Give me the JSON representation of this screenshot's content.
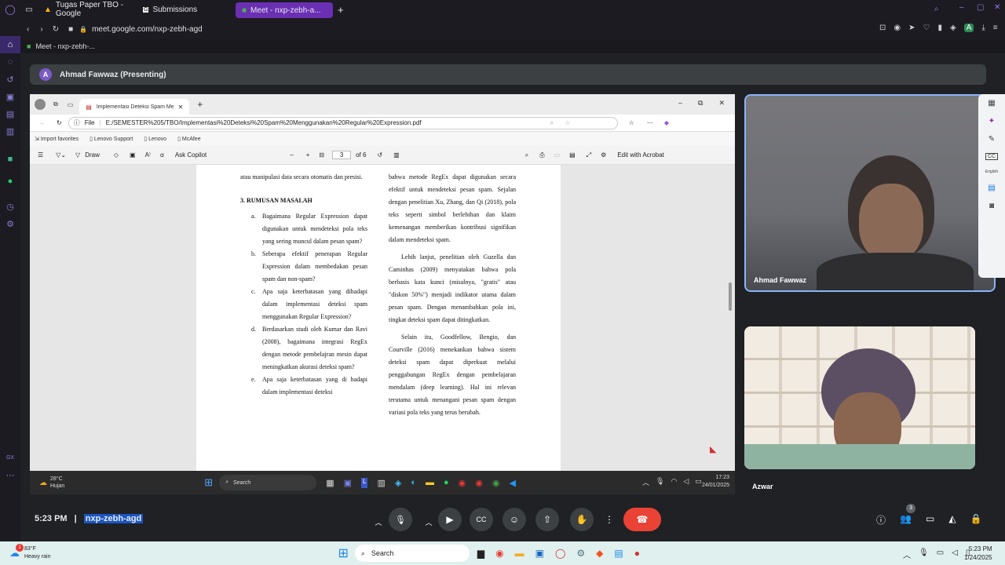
{
  "opera": {
    "tabs": [
      {
        "label": "Tugas Paper TBO - Google"
      },
      {
        "label": "Submissions"
      },
      {
        "label": "Meet - nxp-zebh-a..."
      }
    ],
    "url": "meet.google.com/nxp-zebh-agd",
    "bookmark": "Meet - nxp-zebh-..."
  },
  "meet": {
    "presenting_initial": "A",
    "presenting_label": "Ahmad Fawwaz (Presenting)",
    "time": "5:23 PM",
    "meeting_code": "nxp-zebh-agd",
    "people_count": "3",
    "tiles": [
      {
        "name": "Ahmad Fawwaz"
      },
      {
        "name": "Azwar"
      }
    ],
    "side_labels": {
      "cc": "CC",
      "lang": "English"
    }
  },
  "edge": {
    "tab_title": "Implementasi Deteksi Spam Men",
    "file_label": "File",
    "url": "E:/SEMESTER%205/TBO/Implementasi%20Deteksi%20Spam%20Menggunakan%20Regular%20Expression.pdf",
    "favorites": [
      "Import favorites",
      "Lenovo Support",
      "Lenovo",
      "McAfee"
    ]
  },
  "pdf_toolbar": {
    "draw": "Draw",
    "ask_copilot": "Ask Copilot",
    "page": "3",
    "of": "of 6",
    "edit_acrobat": "Edit with Acrobat"
  },
  "pdf": {
    "left_top": "atau manipulasi data secara otomatis dan presisi.",
    "section_title": "3. RUMUSAN MASALAH",
    "items": [
      {
        "label": "a.",
        "text": "Bagaimana Regular Expression dapat digunakan untuk mendeteksi pola teks yang sering muncul dalam pesan spam?"
      },
      {
        "label": "b.",
        "text": "Seberapa efektif penerapan Regular Expression dalam membedakan pesan spam dan non-spam?"
      },
      {
        "label": "c.",
        "text": "Apa saja keterbatasan yang dihadapi dalam implementasi deteksi spam menggunakan Regular Expression?"
      },
      {
        "label": "d.",
        "text": "Berdasarkan studi oleh Kumar dan Ravi (2008), bagaimana integrasi RegEx dengan metode pembelajran mesin dapat meningkatkan akurasi deteksi spam?"
      },
      {
        "label": "e.",
        "text": "Apa saja keterbatasan yang di hadapi dalam implementasi deteksi"
      }
    ],
    "right_p1": "bahwa metode RegEx dapat digunakan secara efektif untuk mendeteksi pesan spam. Sejalan dengan penelitian Xu, Zhang, dan Qi (2018), pola teks seperti simbol berlebihan dan klaim kemenangan memberikan kontribusi signifikan dalam mendeteksi spam.",
    "right_p2": "Lebih lanjut, penelitian oleh Guzella dan Caminhas (2009) menyatakan bahwa pola berbasis kata kunci (misalnya, \"gratis\" atau \"diskon 50%\") menjadi indikator utama dalam pesan spam. Dengan menambahkan pola ini, tingkat deteksi spam dapat ditingkatkan.",
    "right_p3": "Selain itu, Goodfellow, Bengio, dan Courville (2016) menekankan bahwa sistem deteksi spam dapat diperkuat melalui penggabungan RegEx dengan pembelajaran mendalam (deep learning). Hal ini relevan terutama untuk menangani pesan spam dengan variasi pola teks yang terus berubah."
  },
  "inner_taskbar": {
    "weather_temp": "28°C",
    "weather_desc": "Hujan",
    "search": "Search",
    "time": "17:23",
    "date": "24/01/2025"
  },
  "win_taskbar": {
    "weather_temp": "83°F",
    "weather_desc": "Heavy rain",
    "search": "Search",
    "time": "5:23 PM",
    "date": "1/24/2025",
    "badge": "1"
  },
  "colors": {
    "accent": "#6b2fb3",
    "end_call": "#ea4335",
    "meet_bg": "#202124"
  }
}
